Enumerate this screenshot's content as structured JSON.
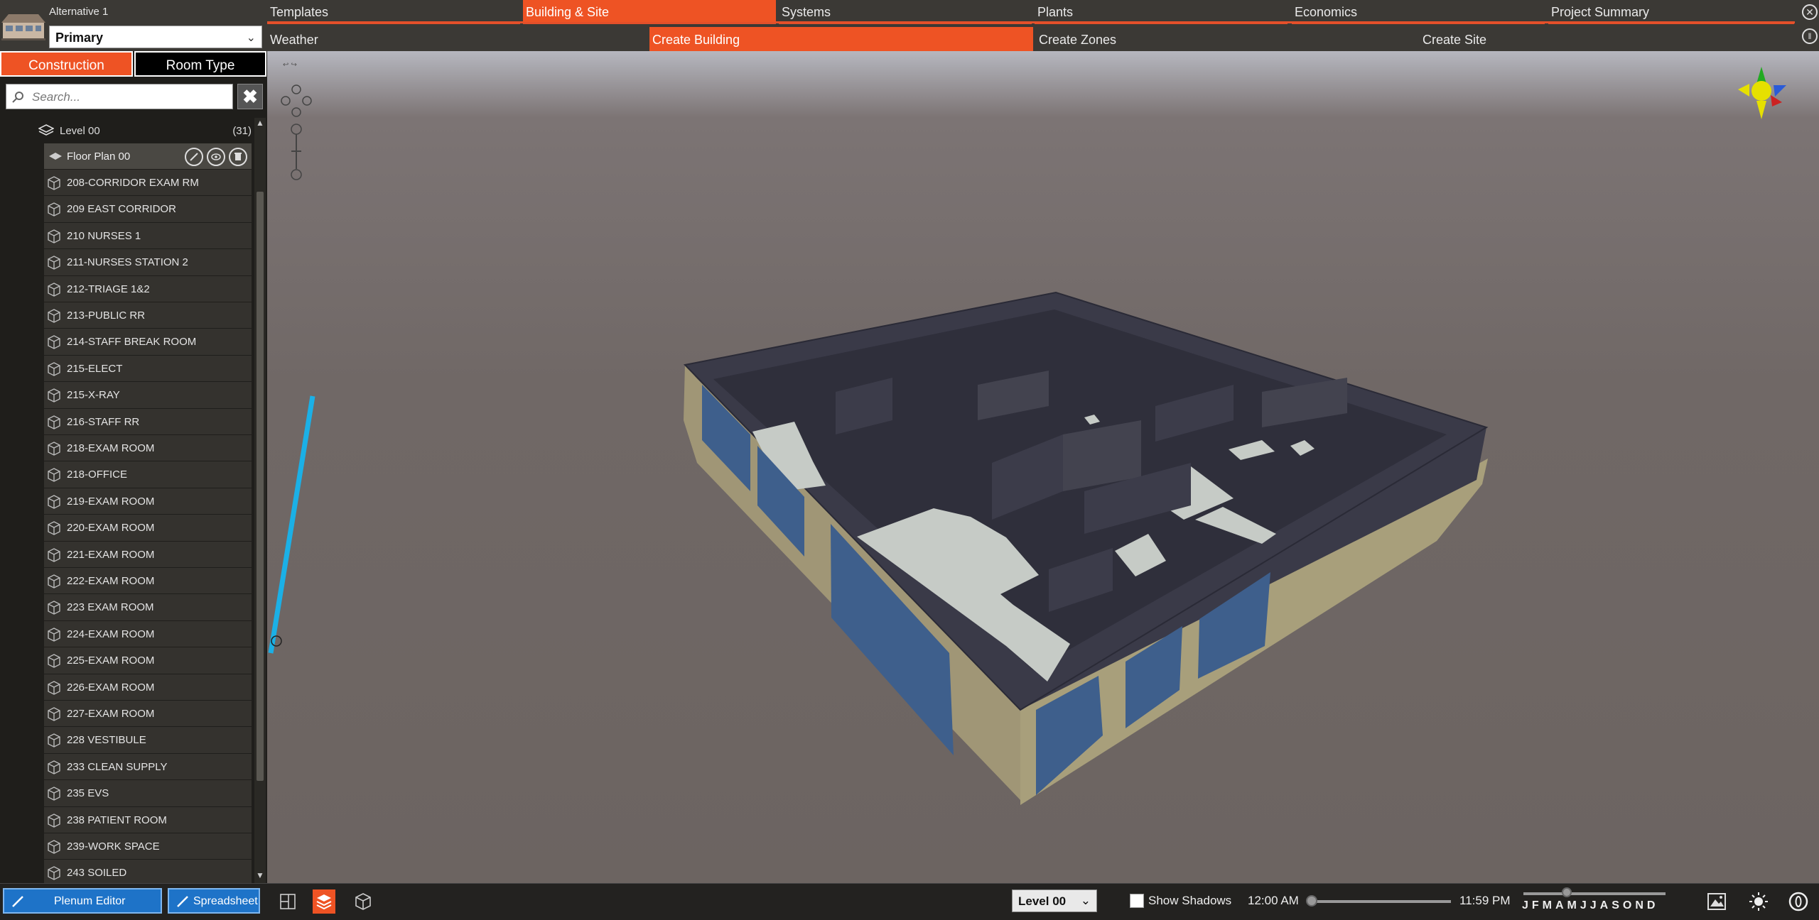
{
  "app": {
    "alternative_label": "Alternative 1",
    "alternative_value": "Primary"
  },
  "nav": {
    "tabs": [
      "Templates",
      "Building & Site",
      "Systems",
      "Plants",
      "Economics",
      "Project Summary"
    ],
    "active_tab": "Building & Site",
    "subtabs": [
      "Weather",
      "Create Building",
      "Create Zones",
      "Create Site"
    ],
    "active_subtab": "Create Building"
  },
  "sidebar": {
    "mode_tabs": [
      "Construction",
      "Room Type"
    ],
    "active_mode": "Construction",
    "search_placeholder": "Search...",
    "level": {
      "label": "Level 00",
      "count": "(31)"
    },
    "floor_plan": "Floor Plan 00",
    "rooms": [
      "208-CORRIDOR EXAM RM",
      "209 EAST CORRIDOR",
      "210 NURSES 1",
      "211-NURSES STATION 2",
      "212-TRIAGE 1&2",
      "213-PUBLIC RR",
      "214-STAFF BREAK ROOM",
      "215-ELECT",
      "215-X-RAY",
      "216-STAFF RR",
      "218-EXAM ROOM",
      "218-OFFICE",
      "219-EXAM ROOM",
      "220-EXAM ROOM",
      "221-EXAM ROOM",
      "222-EXAM ROOM",
      "223 EXAM ROOM",
      "224-EXAM ROOM",
      "225-EXAM ROOM",
      "226-EXAM ROOM",
      "227-EXAM ROOM",
      "228 VESTIBULE",
      "233 CLEAN SUPPLY",
      "235 EVS",
      "238 PATIENT ROOM",
      "239-WORK SPACE",
      "243 SOILED"
    ]
  },
  "bottom": {
    "plenum_editor": "Plenum Editor",
    "spreadsheet": "Spreadsheet",
    "level_value": "Level 00",
    "show_shadows": "Show Shadows",
    "time_start": "12:00 AM",
    "time_end": "11:59 PM",
    "months": "JFMAMJJASOND"
  },
  "colors": {
    "accent": "#ee5324",
    "primary_button": "#1e73c8",
    "roof": "#3a3a48",
    "floor": "#c6cbc6",
    "wall": "#a09676",
    "glass": "#3e5f8c",
    "guide_line": "#1bb0e6"
  }
}
